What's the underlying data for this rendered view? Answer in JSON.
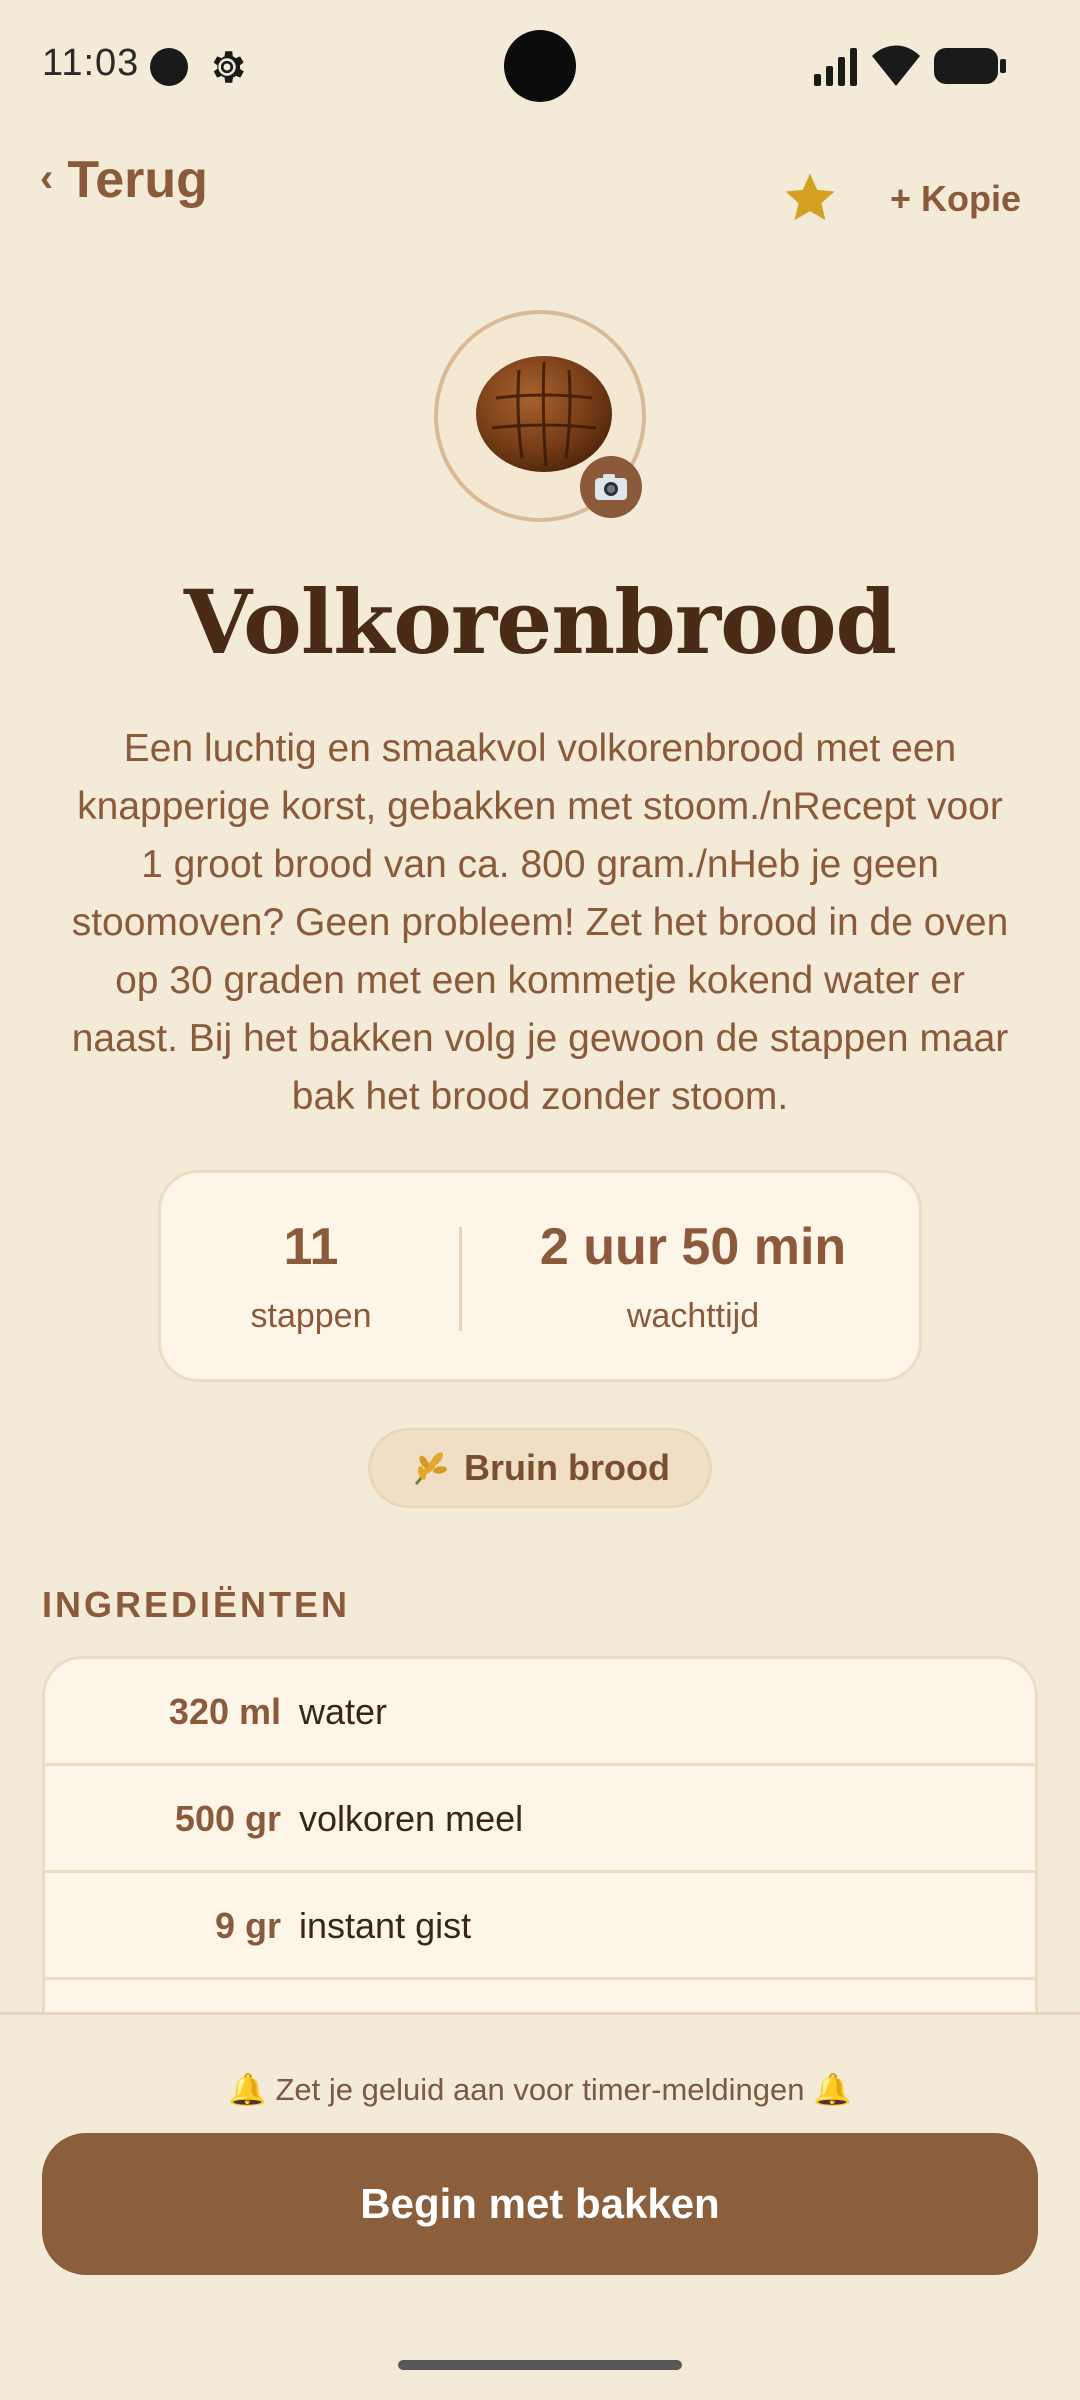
{
  "status_bar": {
    "time": "11:03"
  },
  "header": {
    "back_label": "Terug",
    "copy_label": "+ Kopie",
    "favorite_icon": "star-icon",
    "accent": "#d4a021"
  },
  "recipe": {
    "title": "Volkorenbrood",
    "description": "Een luchtig en smaakvol volkorenbrood met een knapperige korst, gebakken met stoom./nRecept voor 1 groot brood van ca. 800 gram./nHeb je geen stoomoven? Geen probleem! Zet het brood in de oven op 30 graden met een kommetje kokend water er naast. Bij het bakken volg je gewoon de stappen maar bak het brood zonder stoom."
  },
  "stats": {
    "steps_value": "11",
    "steps_label": "stappen",
    "wait_value": "2 uur 50 min",
    "wait_label": "wachttijd"
  },
  "tag": {
    "icon": "wheat-icon",
    "label": "Bruin brood"
  },
  "ingredients": {
    "heading": "INGREDIËNTEN",
    "items": [
      {
        "amount": "320 ml",
        "name": "water"
      },
      {
        "amount": "500 gr",
        "name": "volkoren meel"
      },
      {
        "amount": "9 gr",
        "name": "instant gist"
      }
    ]
  },
  "footer": {
    "sound_hint": "🔔 Zet je geluid aan voor timer-meldingen 🔔",
    "start_label": "Begin met bakken"
  },
  "colors": {
    "background": "#f3ead8",
    "primary": "#8b5e3c",
    "title": "#4a2c16"
  }
}
